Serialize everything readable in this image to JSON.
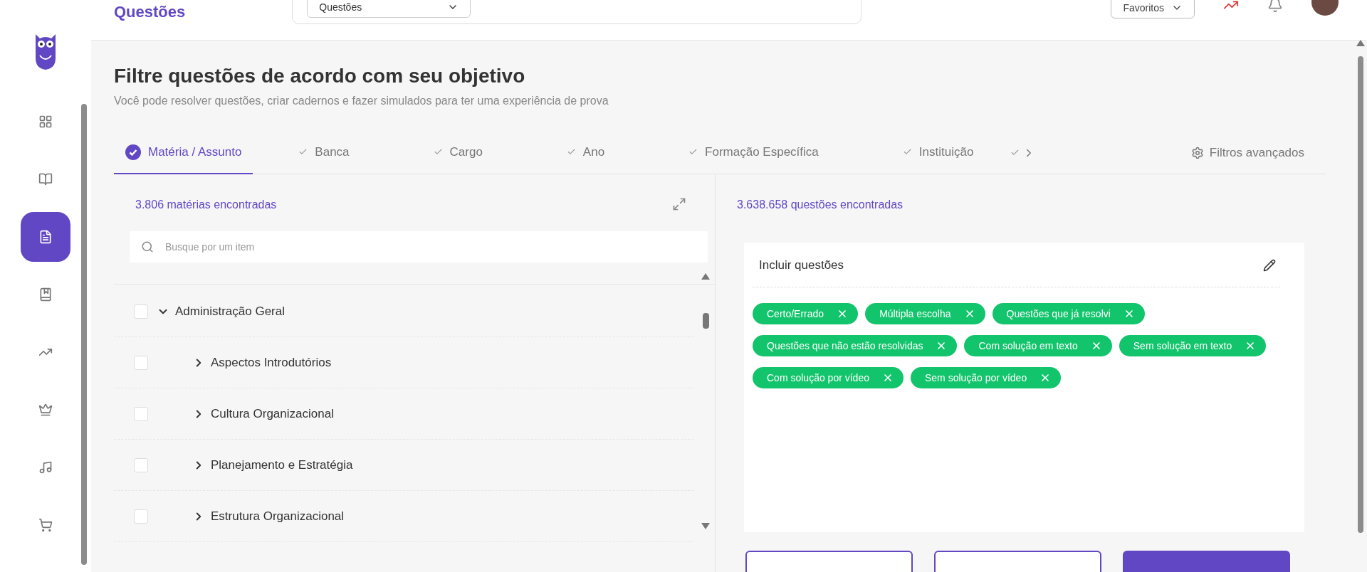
{
  "header": {
    "title": "Questões",
    "dropdown": "Questões",
    "favorites": "Favoritos"
  },
  "heading": {
    "title": "Filtre questões de acordo com seu objetivo",
    "subtitle": "Você pode resolver questões, criar cadernos e fazer simulados para ter uma experiência de prova"
  },
  "sidebar": {
    "items": [
      {
        "selected": false
      },
      {
        "selected": false
      },
      {
        "selected": true
      },
      {
        "selected": false
      },
      {
        "selected": false
      },
      {
        "selected": false
      },
      {
        "selected": false
      },
      {
        "selected": false
      }
    ]
  },
  "tabs": [
    {
      "label": "Matéria / Assunto",
      "selected": true
    },
    {
      "label": "Banca",
      "selected": false
    },
    {
      "label": "Cargo",
      "selected": false
    },
    {
      "label": "Ano",
      "selected": false
    },
    {
      "label": "Formação Específica",
      "selected": false
    },
    {
      "label": "Instituição",
      "selected": false
    }
  ],
  "advanced_filters": "Filtros avançados",
  "subjects": {
    "count": "3.806 matérias encontradas",
    "search": {
      "placeholder": "Busque por um item"
    },
    "tree": [
      {
        "label": "Administração Geral",
        "checked": false,
        "expanded": true,
        "children": [
          {
            "label": "Aspectos Introdutórios",
            "checked": false,
            "expanded": false
          },
          {
            "label": "Cultura Organizacional",
            "checked": false,
            "expanded": false
          },
          {
            "label": "Planejamento e Estratégia",
            "checked": false,
            "expanded": false
          },
          {
            "label": "Estrutura Organizacional",
            "checked": false,
            "expanded": false
          }
        ]
      }
    ]
  },
  "questions": {
    "count": "3.638.658 questões encontradas",
    "include_title": "Incluir questões",
    "chips": [
      "Certo/Errado",
      "Múltipla escolha",
      "Questões que já resolvi",
      "Questões que não estão resolvidas",
      "Com solução em texto",
      "Sem solução em texto",
      "Com solução por vídeo",
      "Sem solução por vídeo"
    ]
  },
  "actions": [
    {
      "kind": "outline"
    },
    {
      "kind": "outline"
    },
    {
      "kind": "primary"
    }
  ]
}
